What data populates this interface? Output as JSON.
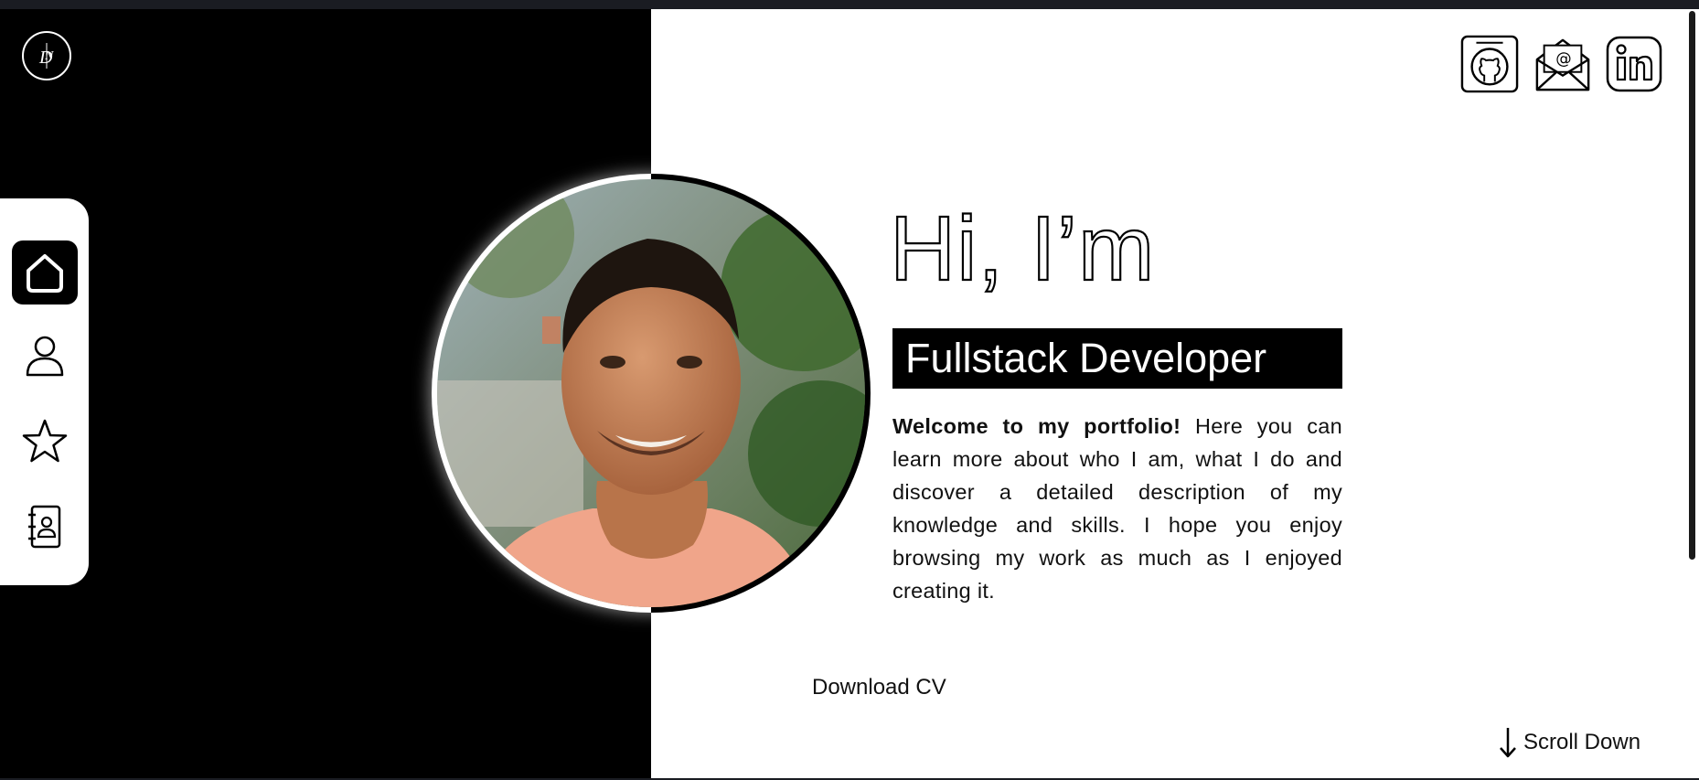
{
  "logo": {
    "icon": "monogram-logo-icon"
  },
  "nav": {
    "items": [
      {
        "icon": "home-icon",
        "active": true
      },
      {
        "icon": "user-icon",
        "active": false
      },
      {
        "icon": "star-icon",
        "active": false
      },
      {
        "icon": "contact-book-icon",
        "active": false
      }
    ]
  },
  "social": {
    "items": [
      {
        "icon": "github-icon"
      },
      {
        "icon": "email-icon"
      },
      {
        "icon": "linkedin-icon"
      }
    ]
  },
  "hero": {
    "greeting": "Hi, I’m",
    "role": "Fullstack Developer",
    "intro_bold": "Welcome to my portfolio!",
    "intro_text": " Here you can learn more about who I am, what I do and discover a detailed description of my knowledge and skills. I hope you enjoy browsing my work as much as I enjoyed creating it.",
    "download_label": "Download CV",
    "scroll_label": "Scroll Down"
  },
  "colors": {
    "background_dark": "#000000",
    "background_light": "#ffffff",
    "accent": "#000000"
  }
}
